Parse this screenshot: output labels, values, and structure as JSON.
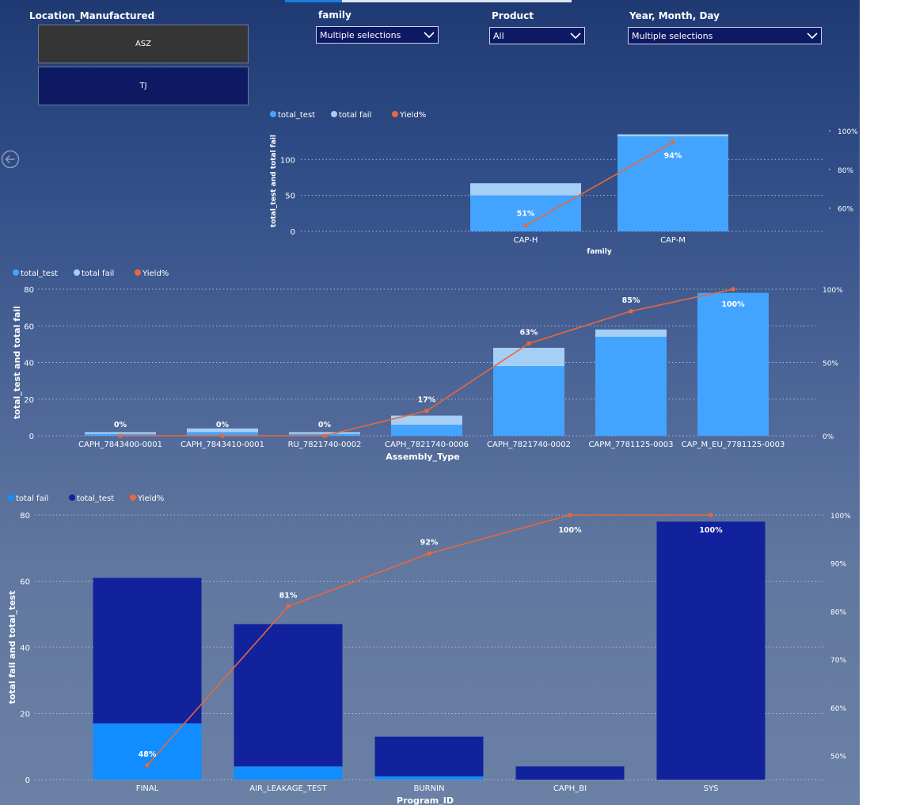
{
  "slicers": {
    "location": {
      "title": "Location_Manufactured",
      "options": [
        "ASZ",
        "TJ"
      ]
    },
    "family": {
      "title": "family",
      "value": "Multiple selections"
    },
    "product": {
      "title": "Product",
      "value": "All"
    },
    "date": {
      "title": "Year, Month, Day",
      "value": "Multiple selections"
    }
  },
  "colors": {
    "total_test_light": "#42a4ff",
    "total_fail_pale": "#a6cff5",
    "yield_line": "#e8683a",
    "total_test_dark": "#12229c",
    "total_fail_bright": "#118dff",
    "tile_selected": "#353535",
    "tile_unselected": "#0d1a63"
  },
  "icons": {
    "back": "back-arrow-icon",
    "dropdown": "chevron-down-icon"
  },
  "chart_data": [
    {
      "type": "bar",
      "stacked": true,
      "combo_line": "Yield%",
      "legend": [
        "total_test",
        "total fail",
        "Yield%"
      ],
      "legend_position": "top-left",
      "categories": [
        "CAP-H",
        "CAP-M"
      ],
      "series": [
        {
          "name": "total_test",
          "values": [
            50,
            132
          ]
        },
        {
          "name": "total fail",
          "values": [
            17,
            3
          ]
        },
        {
          "name": "Yield%",
          "values": [
            51,
            94
          ],
          "labels": [
            "51%",
            "94%"
          ]
        }
      ],
      "xlabel": "family",
      "ylabel": "total_test and total fail",
      "y_ticks": [
        "0",
        "50",
        "100"
      ],
      "y_right_ticks": [
        "60%",
        "80%",
        "100%"
      ],
      "ylim": [
        0,
        140
      ],
      "y_right_lim": [
        48,
        100
      ],
      "grid": true
    },
    {
      "type": "bar",
      "stacked": true,
      "combo_line": "Yield%",
      "legend": [
        "total_test",
        "total fail",
        "Yield%"
      ],
      "legend_position": "top-left",
      "categories": [
        "CAPH_7843400-0001",
        "CAPH_7843410-0001",
        "RU_7821740-0002",
        "CAPH_7821740-0006",
        "CAPH_7821740-0002",
        "CAPM_7781125-0003",
        "CAP_M_EU_7781125-0003"
      ],
      "series": [
        {
          "name": "total_test",
          "values": [
            1,
            2,
            1,
            6,
            38,
            54,
            78
          ]
        },
        {
          "name": "total fail",
          "values": [
            1,
            2,
            1,
            5,
            10,
            4,
            0
          ]
        },
        {
          "name": "Yield%",
          "values": [
            0,
            0,
            0,
            17,
            63,
            85,
            100
          ],
          "labels": [
            "0%",
            "0%",
            "0%",
            "17%",
            "63%",
            "85%",
            "100%"
          ]
        }
      ],
      "xlabel": "Assembly_Type",
      "ylabel": "total_test and total fail",
      "y_ticks": [
        "0",
        "20",
        "40",
        "60",
        "80"
      ],
      "y_right_ticks": [
        "0%",
        "50%",
        "100%"
      ],
      "ylim": [
        0,
        80
      ],
      "y_right_lim": [
        0,
        100
      ],
      "grid": true
    },
    {
      "type": "bar",
      "stacked": true,
      "combo_line": "Yield%",
      "legend": [
        "total fail",
        "total_test",
        "Yield%"
      ],
      "legend_position": "top-left",
      "categories": [
        "FINAL",
        "AIR_LEAKAGE_TEST",
        "BURNIN",
        "CAPH_BI",
        "SYS"
      ],
      "series": [
        {
          "name": "total fail",
          "values": [
            17,
            4,
            1,
            0,
            0
          ]
        },
        {
          "name": "total_test",
          "values": [
            44,
            43,
            12,
            4,
            78
          ]
        },
        {
          "name": "Yield%",
          "values": [
            48,
            81,
            92,
            100,
            100
          ],
          "labels": [
            "48%",
            "81%",
            "92%",
            "100%",
            "100%"
          ]
        }
      ],
      "xlabel": "Program_ID",
      "ylabel": "total fail and total_test",
      "y_ticks": [
        "0",
        "20",
        "40",
        "60",
        "80"
      ],
      "y_right_ticks": [
        "50%",
        "60%",
        "70%",
        "80%",
        "90%",
        "100%"
      ],
      "ylim": [
        0,
        80
      ],
      "y_right_lim": [
        45,
        100
      ],
      "grid": true
    }
  ]
}
